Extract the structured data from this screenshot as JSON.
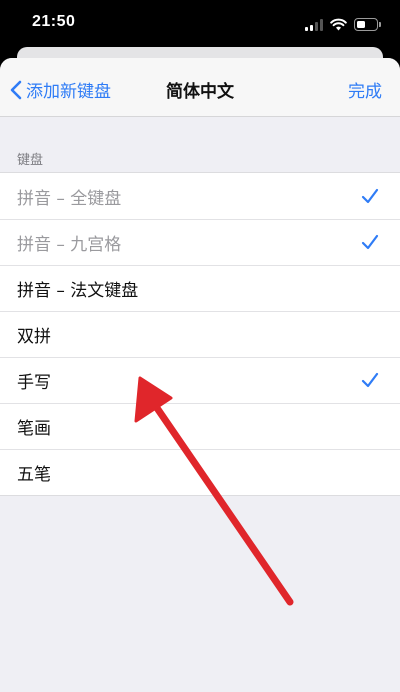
{
  "status_bar": {
    "time": "21:50"
  },
  "nav": {
    "back_label": "添加新键盘",
    "title": "简体中文",
    "done_label": "完成"
  },
  "section_header": "键盘",
  "keyboards": [
    {
      "label": "拼音 – 全键盘",
      "checked": true,
      "dimmed": true
    },
    {
      "label": "拼音 – 九宫格",
      "checked": true,
      "dimmed": true
    },
    {
      "label": "拼音 – 法文键盘",
      "checked": false,
      "dimmed": false
    },
    {
      "label": "双拼",
      "checked": false,
      "dimmed": false
    },
    {
      "label": "手写",
      "checked": true,
      "dimmed": false
    },
    {
      "label": "笔画",
      "checked": false,
      "dimmed": false
    },
    {
      "label": "五笔",
      "checked": false,
      "dimmed": false
    }
  ],
  "colors": {
    "accent": "#2f7cf6",
    "annotation_arrow": "#e0262b"
  },
  "icons": {
    "back": "chevron-left-icon",
    "check": "checkmark-icon",
    "annotation": "red-arrow-annotation"
  }
}
